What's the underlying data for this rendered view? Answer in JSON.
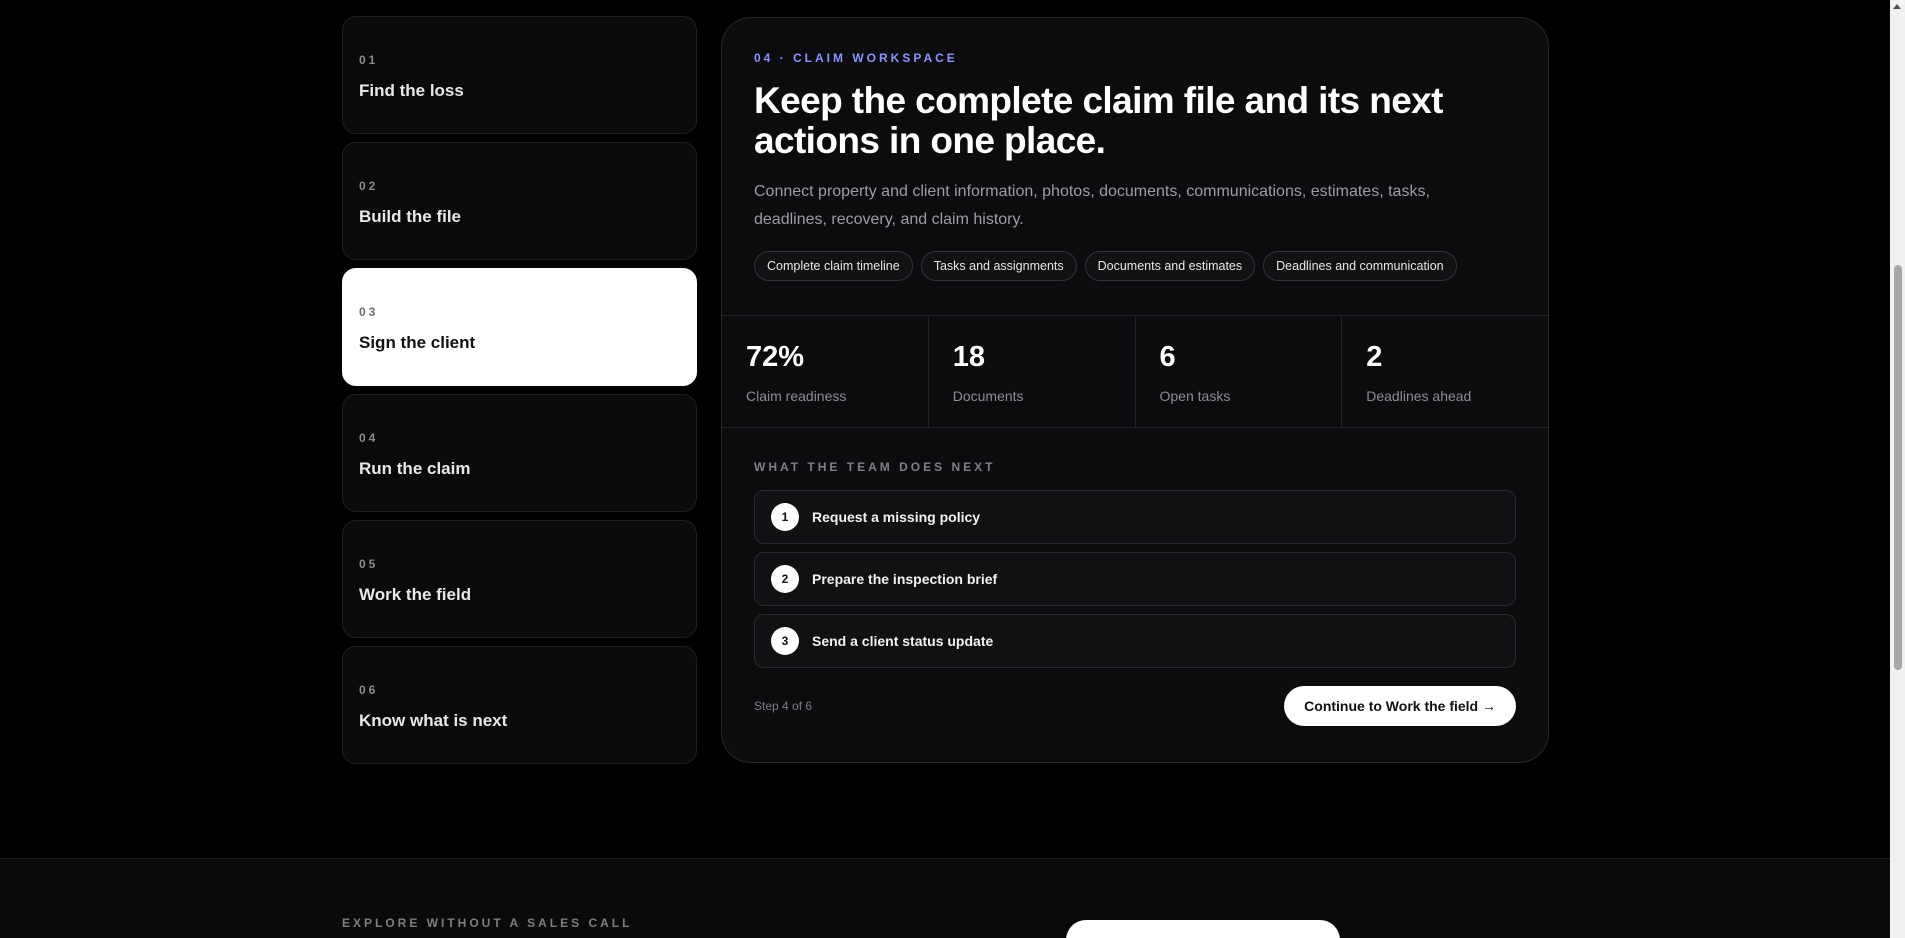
{
  "steps": [
    {
      "num": "01",
      "label": "Find the loss"
    },
    {
      "num": "02",
      "label": "Build the file"
    },
    {
      "num": "03",
      "label": "Sign the client"
    },
    {
      "num": "04",
      "label": "Run the claim"
    },
    {
      "num": "05",
      "label": "Work the field"
    },
    {
      "num": "06",
      "label": "Know what is next"
    }
  ],
  "workspace": {
    "eyebrow": "04 · CLAIM WORKSPACE",
    "headline": "Keep the complete claim file and its next actions in one place.",
    "description": "Connect property and client information, photos, documents, communications, estimates, tasks, deadlines, recovery, and claim history.",
    "chips": [
      "Complete claim timeline",
      "Tasks and assignments",
      "Documents and estimates",
      "Deadlines and communication"
    ],
    "stats": [
      {
        "value": "72%",
        "label": "Claim readiness"
      },
      {
        "value": "18",
        "label": "Documents"
      },
      {
        "value": "6",
        "label": "Open tasks"
      },
      {
        "value": "2",
        "label": "Deadlines ahead"
      }
    ],
    "next_title": "WHAT THE TEAM DOES NEXT",
    "actions": [
      {
        "num": "1",
        "label": "Request a missing policy"
      },
      {
        "num": "2",
        "label": "Prepare the inspection brief"
      },
      {
        "num": "3",
        "label": "Send a client status update"
      }
    ],
    "step_indicator": "Step 4 of 6",
    "continue_label": "Continue to Work the field →"
  },
  "footer": {
    "explore_label": "EXPLORE WITHOUT A SALES CALL"
  },
  "colors": {
    "accent": "#8b93ff",
    "background": "#000000",
    "card": "#0c0c0e"
  }
}
